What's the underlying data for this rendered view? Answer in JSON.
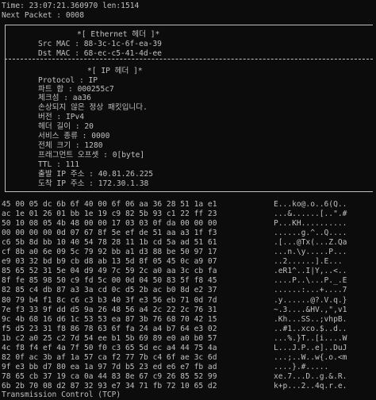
{
  "header": {
    "time_line": "Time: 23:07:21.360970 len:1514",
    "next_packet_line": "Next Packet : 0008"
  },
  "ethernet": {
    "title": "*[ Ethernet 헤더 ]*",
    "src_mac": "Src MAC : 88-3c-1c-6f-ea-39",
    "dst_mac": "Dst MAC : 68-ec-c5-41-4d-ee"
  },
  "ip": {
    "title": "*[ IP 헤더 ]*",
    "fields": [
      "Protocol : IP",
      "파트 합 : 000255c7",
      "체크섬 : aa36",
      "손상되지 않은 정상 패킷입니다.",
      "버전 : IPv4",
      "헤더 길이 : 20",
      "서비스 종류 : 0000",
      "전체 크기 : 1280",
      "프래그먼트 오프셋 : 0[byte]",
      "TTL : 111",
      "출발 IP 주소 : 40.81.26.225",
      "도착 IP 주소 : 172.30.1.38"
    ]
  },
  "hex_dump": {
    "hex": [
      "45 00 05 dc 6b 6f 40 00 6f 06 aa 36 28 51 1a e1",
      "ac 1e 01 26 01 bb 1e 19 c9 82 5b 93 c1 22 ff 23",
      "50 10 08 05 4b 48 00 00 17 03 03 0f da 00 00 00",
      "00 00 00 00 0d 07 67 8f 5e ef de 51 aa a3 1f f3",
      "c6 5b 8d bb 10 40 54 78 28 11 1b cd 5a ad 51 61",
      "cf 8b a0 6e 09 5c 79 92 bb a1 d3 88 be 50 97 17",
      "e9 03 32 bd b9 cb d8 ab 13 5d 8f 05 45 0c a9 07",
      "85 65 52 31 5e 04 d9 49 7c 59 2c a0 aa 3c cb fa",
      "8f fe 85 98 50 c9 fd 5c 00 0d 04 50 83 5f f8 45",
      "82 85 c4 db 87 a3 3a cd 0c d5 2b ac b0 8d e2 37",
      "80 79 b4 f1 8c c6 c3 b3 40 3f e3 56 eb 71 0d 7d",
      "7e f3 33 9f dd d5 9a 26 48 56 a4 2c 22 2c 76 31",
      "9c 4b 68 16 d6 1c 53 53 ea 87 3b 76 68 70 42 15",
      "f5 d5 23 31 f8 86 78 63 6f fa 24 a4 b7 64 e3 02",
      "1b c2 a0 25 c2 7d 54 ee b1 5b 69 89 e0 a0 b0 57",
      "4c f8 f4 ef 4a 7f 50 f0 c3 65 5d ec a4 44 75 4a",
      "82 0f ac 3b af 1a 57 ca f2 77 7b c4 6f ae 3c 6d",
      "9f e3 bb d7 80 ea 1a 97 7d b5 23 ed e6 e7 fb ad",
      "78 65 cb 37 19 ca 0a 44 83 8e 67 c9 26 85 52 99",
      "6b 2b 70 08 d2 87 32 93 e7 34 71 fb 72 10 65 d2"
    ],
    "ascii": [
      "E...ko@.o..6(Q..",
      "...&......[..\".#",
      "P...KH..........",
      "......g.^..Q....",
      ".[...@Tx(...Z.Qa",
      "...n.\\y.....P...",
      "..2......].E...",
      ".eR1^..I|Y,..<..",
      "....P..\\...P._.E",
      "......:...+....7",
      ".y......@?.V.q.}",
      "~.3....&HV.,\",v1",
      ".Kh...SS..;vhpB.",
      "..#1..xco.$..d..",
      "...%.}T..[i....W",
      "L...J.P..e]..DuJ",
      "...;..W..w{.o.<m",
      "....}.#.....",
      "xe.7...D..g.&.R.",
      "k+p...2..4q.r.e."
    ]
  },
  "footer": {
    "text": "Transmission Control (TCP)"
  }
}
